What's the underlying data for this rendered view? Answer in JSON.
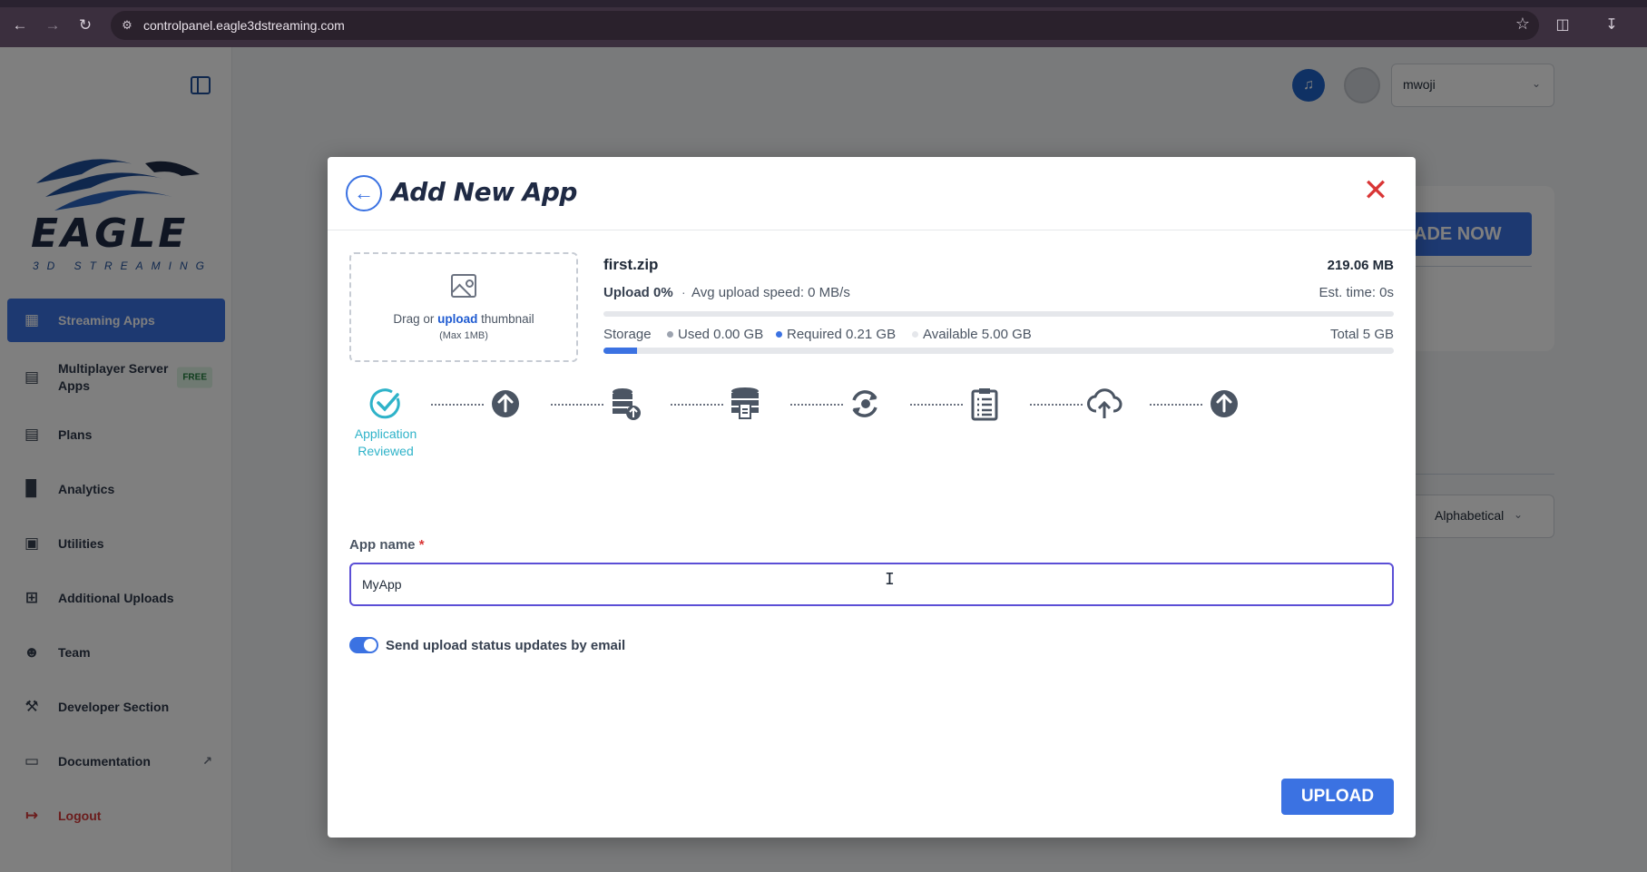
{
  "browser": {
    "url": "controlpanel.eagle3dstreaming.com"
  },
  "sidebar": {
    "logo_word": "EAGLE",
    "logo_sub": "3D STREAMING",
    "items": [
      {
        "label": "Streaming Apps",
        "icon": "grid-icon"
      },
      {
        "label": "Multiplayer Server Apps",
        "icon": "server-icon",
        "badge": "FREE"
      },
      {
        "label": "Plans",
        "icon": "document-icon"
      },
      {
        "label": "Analytics",
        "icon": "bar-chart-icon"
      },
      {
        "label": "Utilities",
        "icon": "presentation-icon"
      },
      {
        "label": "Additional Uploads",
        "icon": "file-plus-icon"
      },
      {
        "label": "Team",
        "icon": "users-icon"
      },
      {
        "label": "Developer Section",
        "icon": "wrench-icon"
      },
      {
        "label": "Documentation",
        "icon": "folder-icon"
      },
      {
        "label": "Logout",
        "icon": "logout-icon"
      }
    ]
  },
  "topbar": {
    "username": "mwoji"
  },
  "background": {
    "upgrade_label": "ADE NOW",
    "sort_value": "Alphabetical"
  },
  "modal": {
    "title": "Add New App",
    "thumbnail": {
      "prefix": "Drag or ",
      "link": "upload",
      "suffix": " thumbnail",
      "hint": "(Max 1MB)"
    },
    "file": {
      "name": "first.zip",
      "size": "219.06 MB",
      "upload_status": "Upload 0%",
      "separator": "·",
      "avg_speed": "Avg upload speed: 0 MB/s",
      "est_time": "Est. time: 0s",
      "upload_progress": 0
    },
    "storage": {
      "label": "Storage",
      "used": "Used 0.00 GB",
      "required": "Required 0.21 GB",
      "available": "Available 5.00 GB",
      "total": "Total 5 GB",
      "fill_fraction": 0.042,
      "colors": {
        "used": "#9ca3af",
        "required": "#3b72e2",
        "available": "#e5e7eb"
      }
    },
    "steps": [
      {
        "icon": "check-circle-icon",
        "label": "Application Reviewed",
        "done": true
      },
      {
        "icon": "arrow-up-circle-icon",
        "label": ""
      },
      {
        "icon": "database-upload-icon",
        "label": ""
      },
      {
        "icon": "database-file-icon",
        "label": ""
      },
      {
        "icon": "refresh-icon",
        "label": ""
      },
      {
        "icon": "clipboard-list-icon",
        "label": ""
      },
      {
        "icon": "cloud-upload-icon",
        "label": ""
      },
      {
        "icon": "arrow-up-circle-icon",
        "label": ""
      }
    ],
    "app_name_label": "App name",
    "app_name_required": "*",
    "app_name_value": "MyApp",
    "email_toggle_label": "Send upload status updates by email",
    "email_toggle_on": true,
    "upload_button": "UPLOAD"
  },
  "colors": {
    "accent": "#3b72e2",
    "step_done": "#2fb3c9",
    "close": "#d93636"
  }
}
